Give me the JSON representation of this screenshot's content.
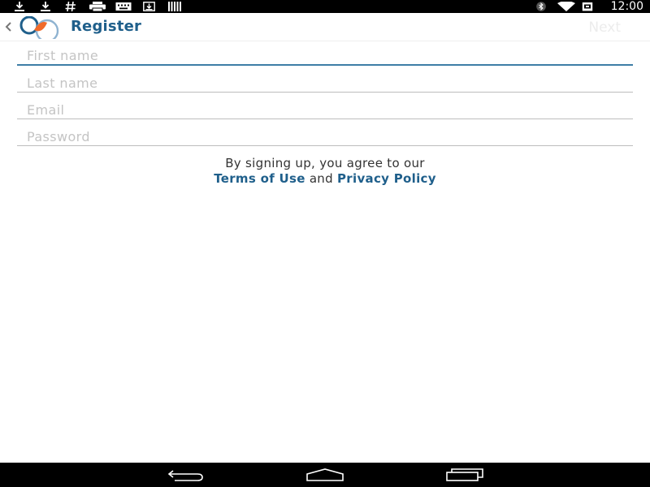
{
  "status_bar": {
    "time": "12:00",
    "icons": [
      "download-icon",
      "download-icon",
      "hash-icon",
      "printer-icon",
      "keyboard-icon",
      "download-box-icon",
      "barcode-icon",
      "bluetooth-icon",
      "wifi-icon",
      "battery-icon"
    ]
  },
  "action_bar": {
    "title": "Register",
    "next_label": "Next"
  },
  "form": {
    "first_name_placeholder": "First name",
    "last_name_placeholder": "Last name",
    "email_placeholder": "Email",
    "password_placeholder": "Password"
  },
  "terms": {
    "line1": "By signing up, you agree to our",
    "terms_link": "Terms of Use",
    "and": "and",
    "privacy_link": "Privacy Policy"
  },
  "colors": {
    "brand_blue": "#1f5f8b",
    "focus_underline": "#3d7ea6",
    "logo_orange": "#f06a2a",
    "logo_blue": "#1f5f8b",
    "logo_light_blue": "#8fb3d1"
  },
  "nav_bar": {
    "icons": [
      "back-icon",
      "home-icon",
      "recents-icon"
    ]
  }
}
